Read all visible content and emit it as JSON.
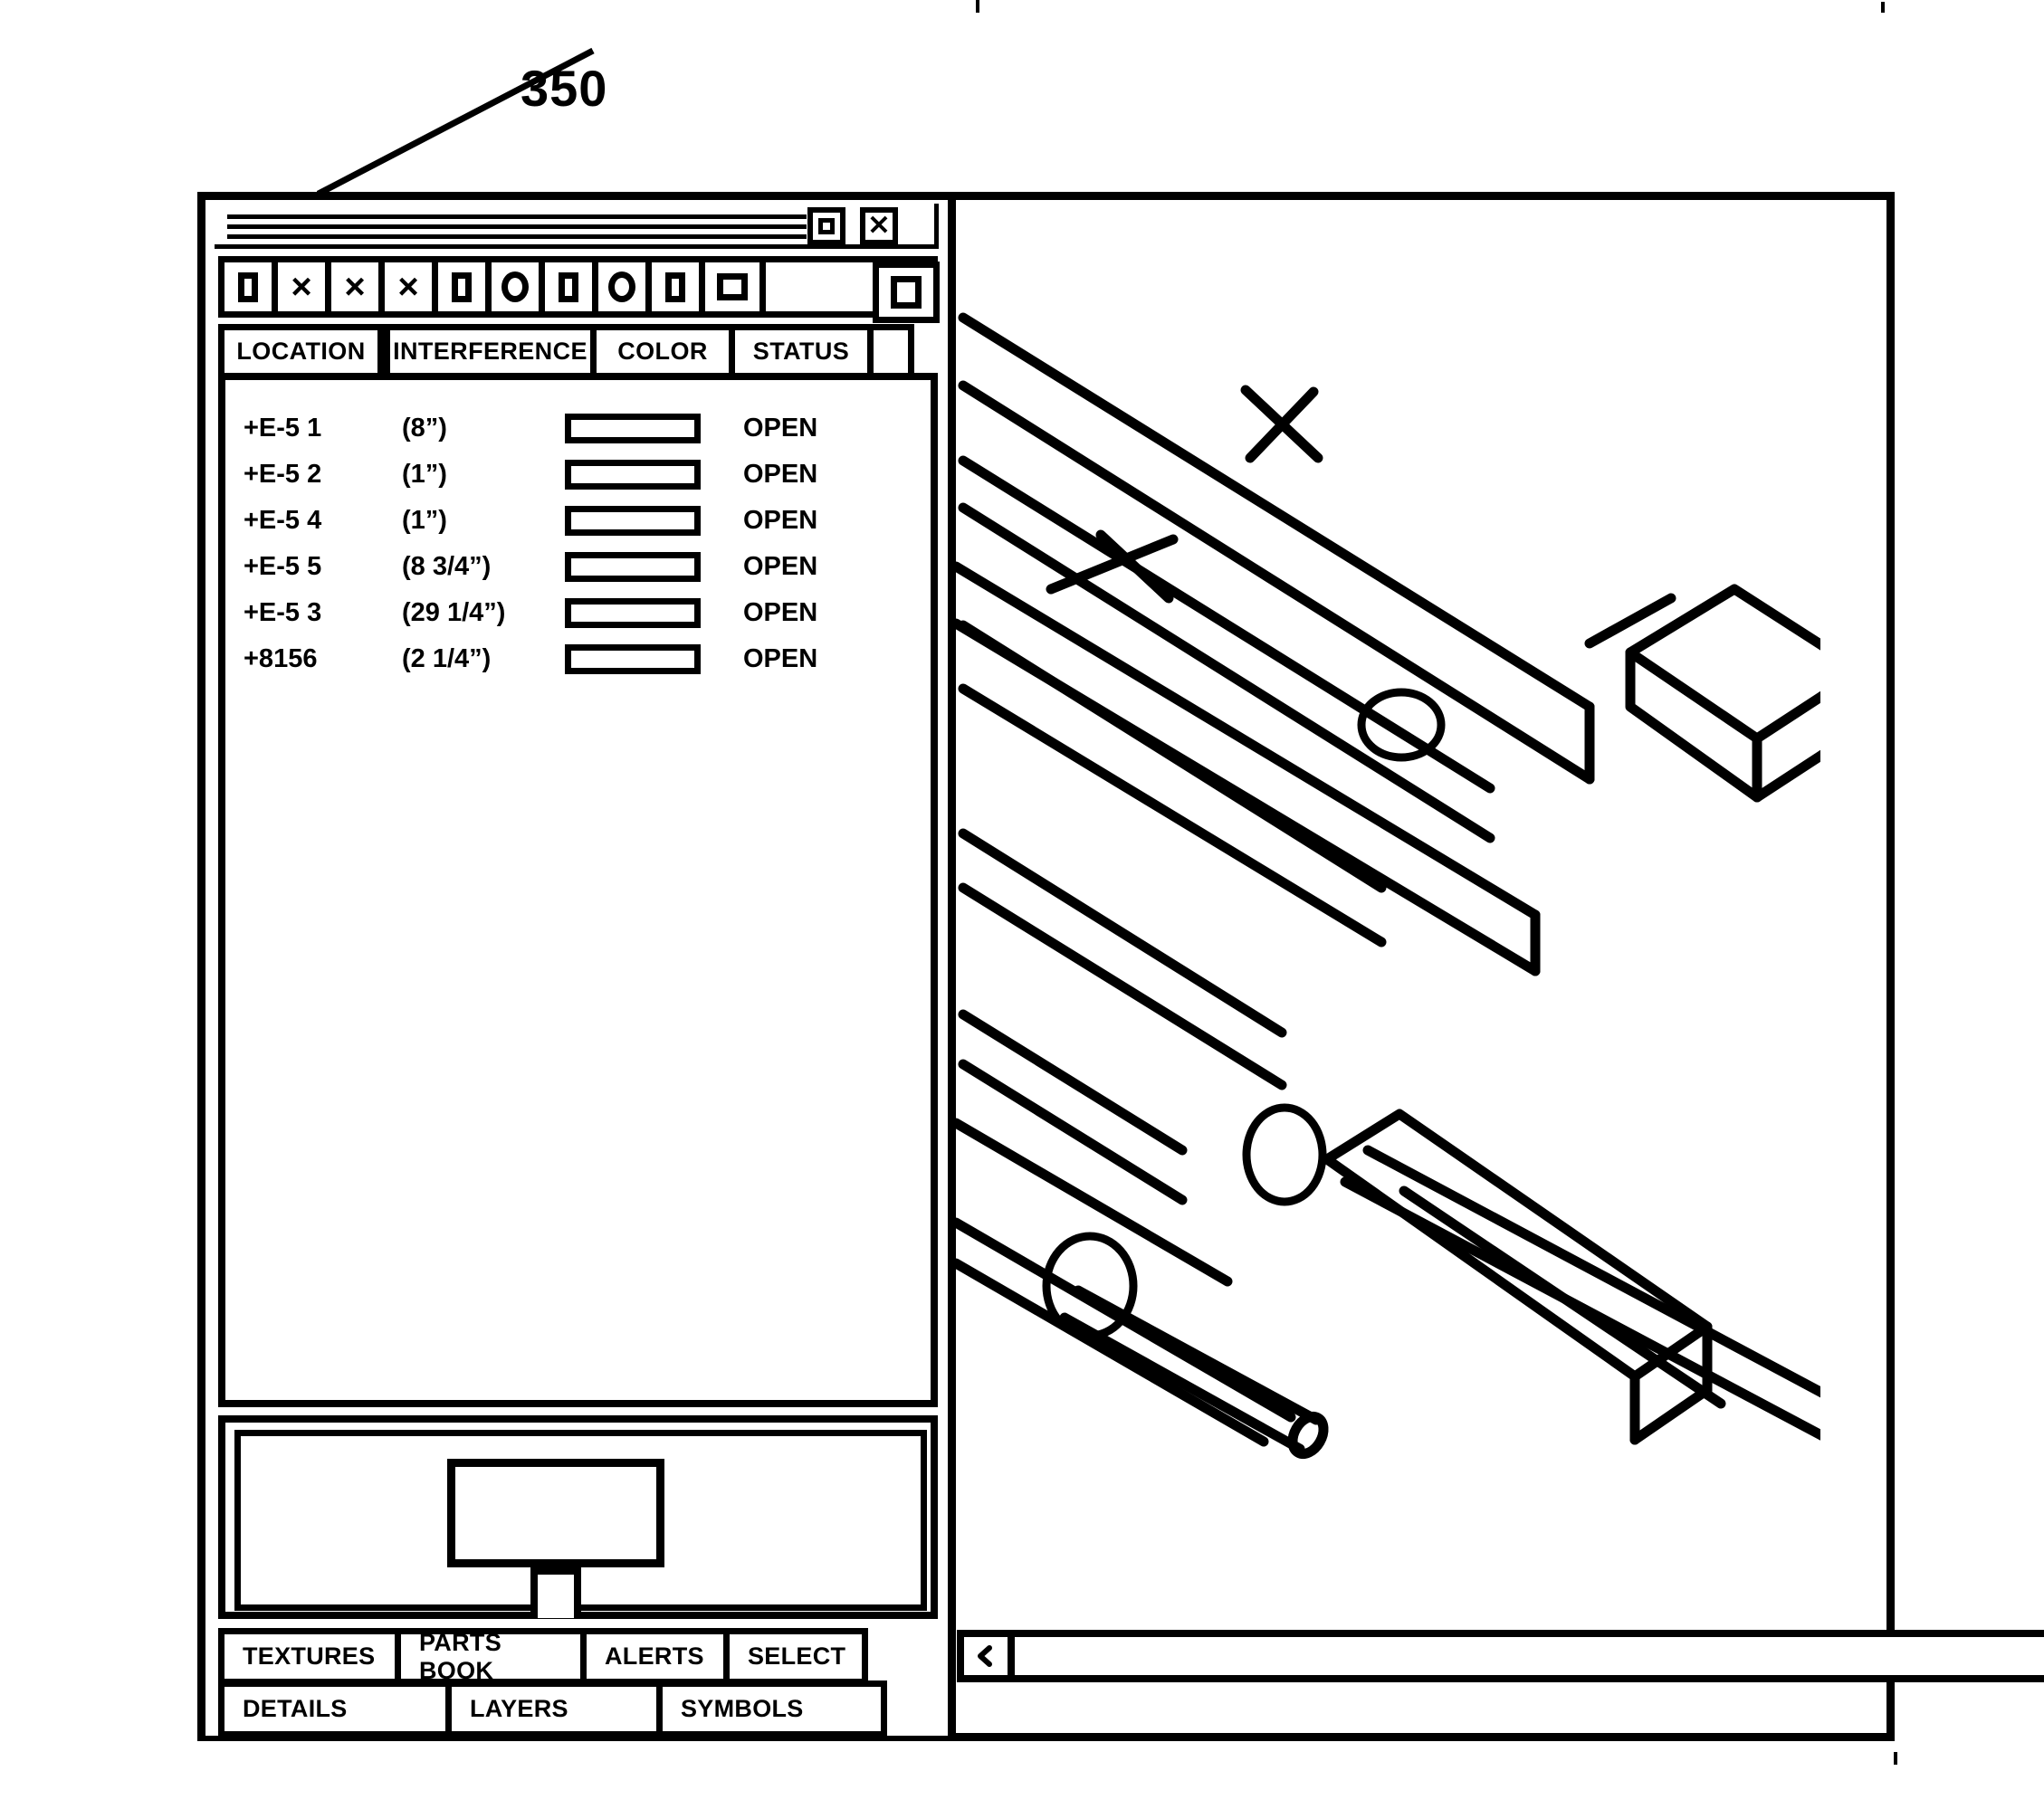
{
  "figure": {
    "reference_number": "350"
  },
  "window": {
    "title_bar": {
      "restore_icon": "restore-icon",
      "close_icon": "close-icon",
      "close_glyph": "✕",
      "rule_count": 3
    },
    "toolbar": {
      "buttons": [
        {
          "name": "tool-button-1",
          "icon": "square-icon"
        },
        {
          "name": "tool-button-2",
          "icon": "x-icon",
          "glyph": "×"
        },
        {
          "name": "tool-button-3",
          "icon": "x-icon",
          "glyph": "×"
        },
        {
          "name": "tool-button-4",
          "icon": "x-icon",
          "glyph": "×"
        },
        {
          "name": "tool-button-5",
          "icon": "square-icon"
        },
        {
          "name": "tool-button-6",
          "icon": "circle-icon"
        },
        {
          "name": "tool-button-7",
          "icon": "square-icon"
        },
        {
          "name": "tool-button-8",
          "icon": "circle-icon"
        },
        {
          "name": "tool-button-9",
          "icon": "square-icon"
        },
        {
          "name": "tool-button-10",
          "icon": "square-wide-icon"
        },
        {
          "name": "tool-button-11",
          "icon": "square-big-icon"
        }
      ]
    },
    "table": {
      "columns": [
        "LOCATION",
        "INTERFERENCE",
        "COLOR",
        "STATUS"
      ],
      "rows": [
        {
          "location": "+E-5 1",
          "interference": "(8”)",
          "color": "",
          "status": "OPEN"
        },
        {
          "location": "+E-5 2",
          "interference": "(1”)",
          "color": "",
          "status": "OPEN"
        },
        {
          "location": "+E-5 4",
          "interference": "(1”)",
          "color": "",
          "status": "OPEN"
        },
        {
          "location": "+E-5 5",
          "interference": "(8 3/4”)",
          "color": "",
          "status": "OPEN"
        },
        {
          "location": "+E-5 3",
          "interference": "(29 1/4”)",
          "color": "",
          "status": "OPEN"
        },
        {
          "location": "+8156",
          "interference": "(2 1/4”)",
          "color": "",
          "status": "OPEN"
        }
      ]
    },
    "preview": {
      "name": "preview-thumbnail",
      "shape": "monitor-on-stand"
    },
    "buttons_row_1": [
      "TEXTURES",
      "PARTS BOOK",
      "ALERTS",
      "SELECT"
    ],
    "buttons_row_2": [
      "DETAILS",
      "LAYERS",
      "SYMBOLS"
    ],
    "viewport": {
      "name": "3d-model-viewport",
      "content": "isometric structural steel frame with beams, braces, pipes and interference markers"
    },
    "scrollbars": {
      "vertical": {
        "up_icon": "chevron-up-icon",
        "down_icon": "chevron-down-icon"
      },
      "horizontal": {
        "left_icon": "chevron-left-icon",
        "right_icon": "chevron-right-icon"
      }
    }
  },
  "colors": {
    "ink": "#000000",
    "paper": "#ffffff"
  }
}
